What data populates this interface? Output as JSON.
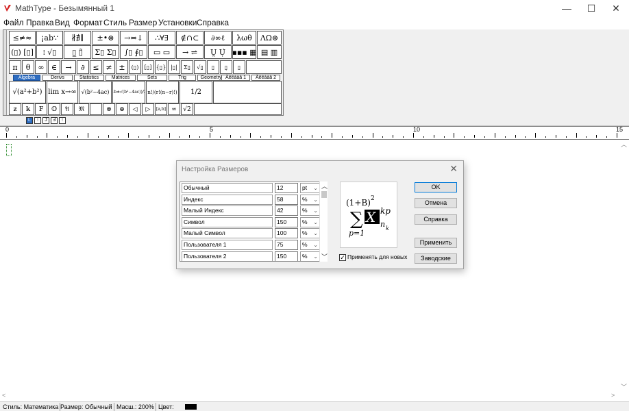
{
  "window": {
    "title": "MathType - Безымянный 1",
    "minimize": "—",
    "maximize": "☐",
    "close": "✕"
  },
  "menu": [
    "Файл",
    "Правка",
    "Вид",
    "Формат",
    "Стиль",
    "Размер",
    "Установки",
    "Справка"
  ],
  "palette": {
    "row1": [
      "≤≠≈",
      "¡ab∵",
      "∦∄∥",
      "±•⊗",
      "→⇔↓",
      "∴∀∃",
      "∉∩⊂",
      "∂∞ℓ",
      "λωθ",
      "ΛΩ⊛"
    ],
    "row2": [
      "(▯) [▯]",
      "⁞ √▯",
      "▯̲ ▯̃",
      "Σ▯ Σ▯",
      "∫▯ ∮▯",
      "▭ ▭",
      "→ ⇌",
      "Ṵ Ụ̇",
      "▪▪▪ ▦",
      "▤ ▥"
    ],
    "row3": [
      "π",
      "θ",
      "∞",
      "∈",
      "→",
      "∂",
      "≤",
      "≠",
      "±",
      "(▯)",
      "[▯]",
      "{▯}",
      "|▯|",
      "Σ▯",
      "√▯",
      "▯",
      "▯̣",
      "▯"
    ],
    "tabs": [
      "Algebra",
      "Derivs",
      "Statistics",
      "Matrices",
      "Sets",
      "Trig",
      "Geometry",
      "Àêêååâ 1",
      "Àêêååâ 2"
    ],
    "active_tab": "Algebra",
    "templates": [
      "√(a²+b²)",
      "lim x→∞",
      "√(b²−4ac)",
      "(−b±√(b²−4ac))/2a",
      "n!/(r!(n−r)!)",
      "1/2"
    ],
    "row5": [
      "𝕫",
      "𝕜",
      "𝔽",
      "𝕆",
      "𝔄",
      "𝔐",
      "⊗",
      "⊕",
      "◁",
      "▷",
      "[a,b]",
      "∞",
      "√2"
    ],
    "small_tools": [
      "L",
      "↑",
      "J",
      "Ⅎ",
      "↑"
    ]
  },
  "ruler": {
    "marks": [
      "0",
      "5",
      "10",
      "15"
    ]
  },
  "dialog": {
    "title": "Настройка Размеров",
    "rows": [
      {
        "label": "Обычный",
        "value": "12",
        "unit": "pt"
      },
      {
        "label": "Индекс",
        "value": "58",
        "unit": "%"
      },
      {
        "label": "Малый Индекс",
        "value": "42",
        "unit": "%"
      },
      {
        "label": "Символ",
        "value": "150",
        "unit": "%"
      },
      {
        "label": "Малый Символ",
        "value": "100",
        "unit": "%"
      },
      {
        "label": "Пользователя 1",
        "value": "75",
        "unit": "%"
      },
      {
        "label": "Пользователя 2",
        "value": "150",
        "unit": "%"
      }
    ],
    "buttons": {
      "ok": "OK",
      "cancel": "Отмена",
      "help": "Справка",
      "apply": "Применить",
      "defaults": "Заводские"
    },
    "checkbox_label": "Применять для новых",
    "checkbox_checked": true,
    "preview": {
      "base": "(1+B)",
      "exp": "2",
      "sigma": "∑",
      "var": "X",
      "sup": "kp",
      "sub": "n",
      "subsub": "k",
      "lower": "p=1"
    }
  },
  "status": {
    "style": "Стиль: Математика",
    "size": "Размер: Обычный",
    "zoom": "Масш.: 200%",
    "color": "Цвет:",
    "color_value": "#000000"
  }
}
